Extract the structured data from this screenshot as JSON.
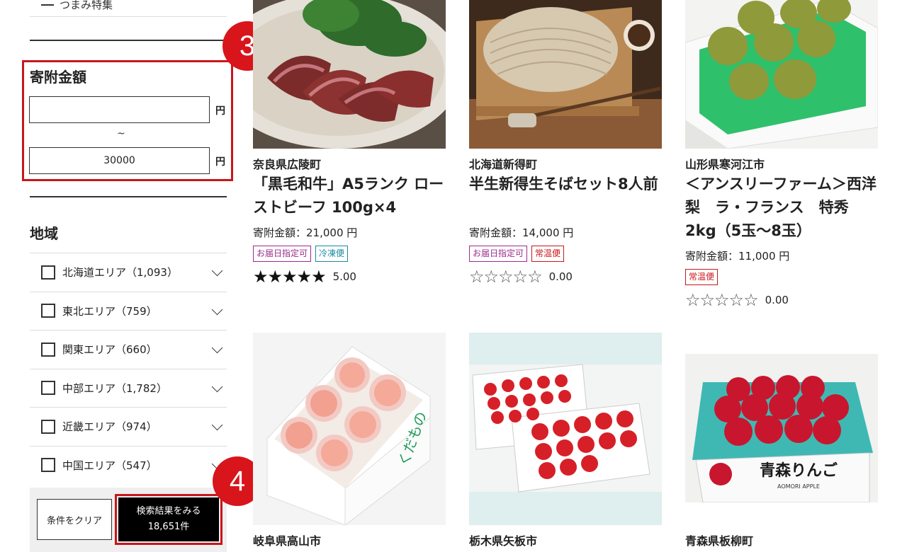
{
  "sidebar": {
    "prev_item_label": "つまみ特集",
    "amount": {
      "title": "寄附金額",
      "min_value": "",
      "max_value": "30000",
      "yen": "円",
      "tilde": "~",
      "badge": "3"
    },
    "region": {
      "title": "地域",
      "items": [
        {
          "label": "北海道エリア（1,093）"
        },
        {
          "label": "東北エリア（759）"
        },
        {
          "label": "関東エリア（660）"
        },
        {
          "label": "中部エリア（1,782）"
        },
        {
          "label": "近畿エリア（974）"
        },
        {
          "label": "中国エリア（547）"
        }
      ]
    },
    "actions": {
      "clear_label": "条件をクリア",
      "search_label": "検索結果をみる",
      "search_count": "18,651件",
      "badge": "4"
    }
  },
  "products": [
    {
      "location": "奈良県広陵町",
      "title": "「黒毛和牛」A5ランク ローストビーフ 100g×4",
      "price": "寄附金額：21,000 円",
      "tags": [
        "お届日指定可",
        "冷凍便"
      ],
      "stars": "★★★★★",
      "rating": "5.00"
    },
    {
      "location": "北海道新得町",
      "title": "半生新得生そばセット8人前",
      "price": "寄附金額：14,000 円",
      "tags": [
        "お届日指定可",
        "常温便"
      ],
      "stars": "☆☆☆☆☆",
      "rating": "0.00"
    },
    {
      "location": "山形県寒河江市",
      "title": "＜アンスリーファーム＞西洋梨　ラ・フランス　特秀2kg（5玉～8玉）",
      "price": "寄附金額：11,000 円",
      "tags": [
        "常温便"
      ],
      "stars": "☆☆☆☆☆",
      "rating": "0.00"
    },
    {
      "location": "岐阜県高山市"
    },
    {
      "location": "栃木県矢板市"
    },
    {
      "location": "青森県板柳町"
    }
  ],
  "images": {
    "apple_box_text": "青森りんご",
    "apple_box_sub": "AOMORI APPLE",
    "peach_box_text": "くだもの"
  }
}
